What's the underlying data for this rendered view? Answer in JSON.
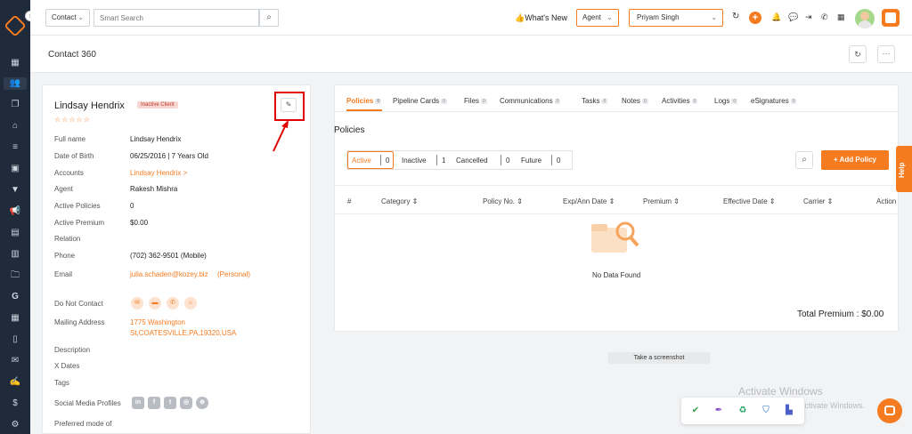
{
  "colors": {
    "accent": "#f47b20",
    "sidebar": "#1f2a3a",
    "annotation": "#e00000",
    "badge_bg": "#f8d7d3",
    "badge_text": "#c0392b"
  },
  "topbar": {
    "entity_select": "Contact",
    "search_placeholder": "Smart Search",
    "whats_new": "What's New",
    "role_select": "Agent",
    "user_select": "Priyam Singh"
  },
  "page": {
    "title": "Contact 360"
  },
  "contact": {
    "name": "Lindsay Hendrix",
    "status": "Inactive Client",
    "rating": "☆☆☆☆☆",
    "fields": [
      {
        "label": "Full name",
        "value": "Lindsay Hendrix"
      },
      {
        "label": "Date of Birth",
        "value": "06/25/2016 | 7 Years Old"
      },
      {
        "label": "Accounts",
        "value": "Lindsay Hendrix >"
      },
      {
        "label": "Agent",
        "value": "Rakesh Mishra"
      },
      {
        "label": "Active Policies",
        "value": "0"
      },
      {
        "label": "Active Premium",
        "value": "$0.00"
      },
      {
        "label": "Relation",
        "value": ""
      },
      {
        "label": "Phone",
        "value": "(702) 362-9501 (Mobile)"
      },
      {
        "label": "Email",
        "value": "julia.schaden@kozey.biz",
        "extra": "(Personal)"
      }
    ],
    "do_not_contact_label": "Do Not Contact",
    "mailing_label": "Mailing Address",
    "mailing_line1": "1775 Washington",
    "mailing_line2": "St,COATESVILLE,PA,19320,USA",
    "description_label": "Description",
    "xdates_label": "X Dates",
    "tags_label": "Tags",
    "social_label": "Social Media Profiles",
    "preferred_label": "Preferred mode of"
  },
  "tabs": [
    {
      "label": "Policies",
      "count": "0"
    },
    {
      "label": "Pipeline Cards",
      "count": "0"
    },
    {
      "label": "Files",
      "count": "0"
    },
    {
      "label": "Communications",
      "count": "0"
    },
    {
      "label": "Tasks",
      "count": "0"
    },
    {
      "label": "Notes",
      "count": "0"
    },
    {
      "label": "Activities",
      "count": "0"
    },
    {
      "label": "Logs",
      "count": "0"
    },
    {
      "label": "eSignatures",
      "count": "0"
    }
  ],
  "policies": {
    "heading": "Policies",
    "filters": [
      {
        "label": "Active",
        "count": "0"
      },
      {
        "label": "Inactive",
        "count": "1"
      },
      {
        "label": "Cancelled",
        "count": "0"
      },
      {
        "label": "Future",
        "count": "0"
      }
    ],
    "add_button": "+ Add Policy",
    "columns": [
      "#",
      "Category ⇕",
      "Policy No. ⇕",
      "Exp/Ann Date ⇕",
      "Premium ⇕",
      "Effective Date ⇕",
      "Carrier ⇕",
      "Action"
    ],
    "empty_text": "No Data Found",
    "total_label": "Total Premium : $0.00"
  },
  "help_tab": "Help",
  "screenshot_button": "Take a screenshot",
  "activate": {
    "title": "Activate Windows",
    "subtitle": "Go to Settings to activate Windows."
  }
}
